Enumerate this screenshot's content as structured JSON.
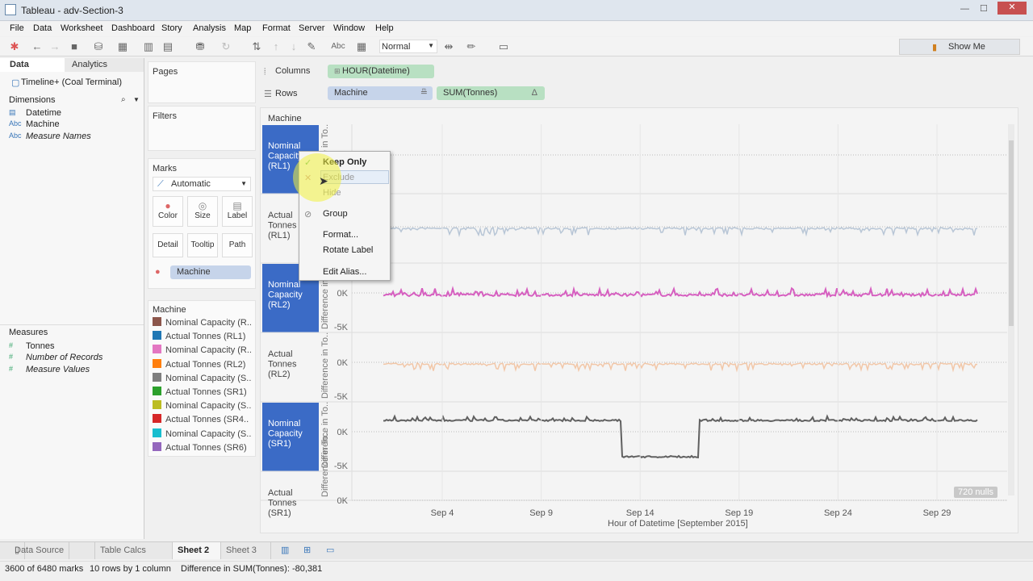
{
  "window": {
    "title": "Tableau - adv-Section-3"
  },
  "menu": [
    "File",
    "Data",
    "Worksheet",
    "Dashboard",
    "Story",
    "Analysis",
    "Map",
    "Format",
    "Server",
    "Window",
    "Help"
  ],
  "toolbar": {
    "view_size": "Normal",
    "show_me": "Show Me"
  },
  "left": {
    "tabs": [
      "Data",
      "Analytics"
    ],
    "datasource": "Timeline+ (Coal Terminal)",
    "dimensions_label": "Dimensions",
    "dimensions": [
      "Datetime",
      "Machine",
      "Measure Names"
    ],
    "measures_label": "Measures",
    "measures": [
      "Tonnes",
      "Number of Records",
      "Measure Values"
    ]
  },
  "cards": {
    "pages": "Pages",
    "filters": "Filters",
    "marks": "Marks",
    "mark_type": "Automatic",
    "mark_buttons": [
      "Color",
      "Size",
      "Label",
      "Detail",
      "Tooltip",
      "Path"
    ],
    "color_pill": "Machine"
  },
  "legend": {
    "title": "Machine",
    "items": [
      {
        "label": "Nominal Capacity (R..",
        "color": "#8c564b"
      },
      {
        "label": "Actual Tonnes (RL1)",
        "color": "#1f77b4"
      },
      {
        "label": "Nominal Capacity (R..",
        "color": "#e377c2"
      },
      {
        "label": "Actual Tonnes (RL2)",
        "color": "#ff7f0e"
      },
      {
        "label": "Nominal Capacity (S..",
        "color": "#7f7f7f"
      },
      {
        "label": "Actual Tonnes (SR1)",
        "color": "#2ca02c"
      },
      {
        "label": "Nominal Capacity (S..",
        "color": "#bcbd22"
      },
      {
        "label": "Actual Tonnes (SR4..",
        "color": "#d62728"
      },
      {
        "label": "Nominal Capacity (S..",
        "color": "#17becf"
      },
      {
        "label": "Actual Tonnes (SR6)",
        "color": "#9467bd"
      }
    ]
  },
  "shelves": {
    "columns_label": "Columns",
    "columns": "HOUR(Datetime)",
    "rows_label": "Rows",
    "rows": [
      "Machine",
      "SUM(Tonnes)"
    ]
  },
  "view": {
    "header": "Machine",
    "axis_title": "Difference in To..",
    "x_title": "Hour of Datetime [September 2015]",
    "x_ticks": [
      "Sep 4",
      "Sep 9",
      "Sep 14",
      "Sep 19",
      "Sep 24",
      "Sep 29"
    ],
    "nulls": "720 nulls",
    "panes": [
      {
        "label": "Nominal Capacity (RL1)",
        "selected": true,
        "color": "#8c564b",
        "ticks": [],
        "visible": false
      },
      {
        "label": "Actual Tonnes (RL1)",
        "selected": false,
        "color": "#b8c6d6",
        "ticks": [],
        "visible": true
      },
      {
        "label": "Nominal Capacity (RL2)",
        "selected": true,
        "color": "#d65fc0",
        "ticks": [
          "0K",
          "-5K"
        ],
        "visible": true
      },
      {
        "label": "Actual Tonnes (RL2)",
        "selected": false,
        "color": "#f2c7a8",
        "ticks": [
          "0K",
          "-5K"
        ],
        "visible": true
      },
      {
        "label": "Nominal Capacity (SR1)",
        "selected": true,
        "color": "#606060",
        "ticks": [
          "0K",
          "-5K"
        ],
        "visible": true
      },
      {
        "label": "Actual Tonnes (SR1)",
        "selected": false,
        "color": "#8fcf8f",
        "ticks": [
          "0K"
        ],
        "visible": false
      }
    ]
  },
  "context_menu": {
    "items": [
      "Keep Only",
      "Exclude",
      "Hide",
      "Group",
      "Format...",
      "Rotate Label",
      "Edit Alias..."
    ]
  },
  "sheet_tabs": {
    "datasource": "Data Source",
    "tabs": [
      "Table Calcs Testing",
      "Sheet 2",
      "Sheet 3"
    ],
    "active": "Sheet 2"
  },
  "status": {
    "marks": "3600 of 6480 marks",
    "dims": "10 rows by 1 column",
    "sum": "Difference in SUM(Tonnes): -80,381"
  }
}
